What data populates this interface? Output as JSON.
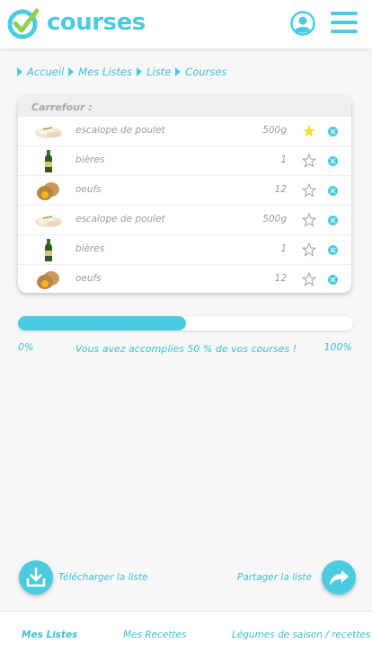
{
  "app": {
    "logo_text": "courses",
    "colors": {
      "accent": "#4ccbe0",
      "accent_text": "#3fbfd6",
      "logo_check_green": "#8fd14f",
      "star_active": "#f5e234"
    }
  },
  "header": {
    "profile_icon": "user-circle-icon",
    "menu_icon": "hamburger-menu-icon"
  },
  "breadcrumb": [
    "Accueil",
    "Mes Listes",
    "Liste",
    "Courses"
  ],
  "list": {
    "store": "Carrefour :",
    "items": [
      {
        "name": "escalope de poulet",
        "qty": "500g",
        "favorite": true,
        "image": "chicken-breast"
      },
      {
        "name": "bières",
        "qty": "1",
        "favorite": false,
        "image": "beer-bottle"
      },
      {
        "name": "oeufs",
        "qty": "12",
        "favorite": false,
        "image": "eggs"
      },
      {
        "name": "escalope de poulet",
        "qty": "500g",
        "favorite": false,
        "image": "chicken-breast"
      },
      {
        "name": "bières",
        "qty": "1",
        "favorite": false,
        "image": "beer-bottle"
      },
      {
        "name": "oeufs",
        "qty": "12",
        "favorite": false,
        "image": "eggs"
      }
    ]
  },
  "progress": {
    "value_percent": 50,
    "min_label": "0%",
    "max_label": "100%",
    "message": "Vous avez  accomplies 50 % de vos courses !"
  },
  "actions": {
    "download_label": "Télécharger la liste",
    "share_label": "Partager la liste"
  },
  "bottom_nav": {
    "items": [
      "Mes Listes",
      "Mes Recettes",
      "Légumes de saison / recettes"
    ],
    "active": 0
  }
}
